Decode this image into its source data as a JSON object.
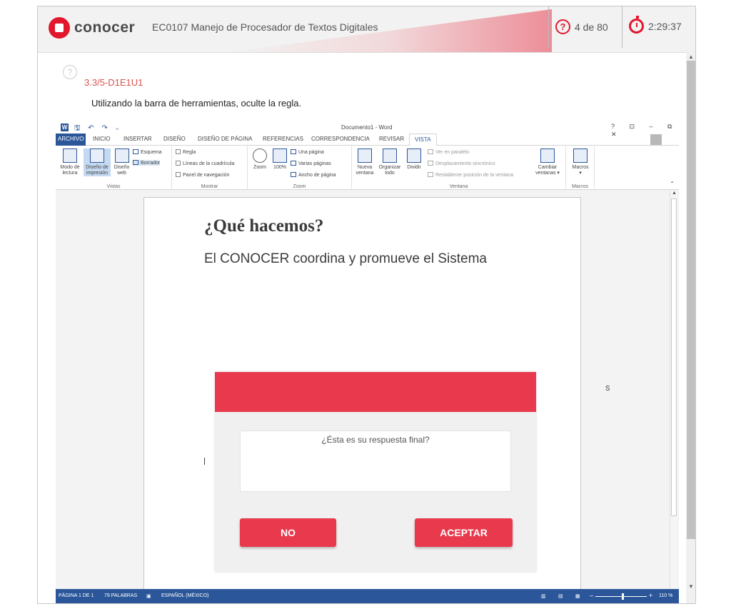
{
  "exam": {
    "brand": "conocer",
    "title": "EC0107 Manejo de Procesador de Textos Digitales",
    "question_counter": "4 de 80",
    "timer": "2:29:37",
    "help_glyph": "?",
    "question_code": "3.3/5-D1E1U1",
    "instruction": "Utilizando la barra de herramientas, oculte la regla."
  },
  "word": {
    "title": "Documento1 - Word",
    "qat": "🖫 ↶ ↷ ₌",
    "window_controls": "? ⊡ – ⧉ ✕",
    "tabs": [
      "ARCHIVO",
      "INICIO",
      "INSERTAR",
      "DISEÑO",
      "DISEÑO DE PÁGINA",
      "REFERENCIAS",
      "CORRESPONDENCIA",
      "REVISAR",
      "VISTA"
    ],
    "ribbon": {
      "vistas": {
        "label": "Vistas",
        "modo_lectura_1": "Modo de",
        "modo_lectura_2": "lectura",
        "diseno_impresion_1": "Diseño de",
        "diseno_impresion_2": "impresión",
        "diseno_web_1": "Diseño",
        "diseno_web_2": "web",
        "esquema": "Esquema",
        "borrador": "Borrador"
      },
      "mostrar": {
        "label": "Mostrar",
        "regla": "Regla",
        "lineas": "Líneas de la cuadrícula",
        "panel": "Panel de navegación"
      },
      "zoom": {
        "label": "Zoom",
        "zoom": "Zoom",
        "cien": "100%",
        "una_pagina": "Una página",
        "varias_paginas": "Varias páginas",
        "ancho_pagina": "Ancho de página"
      },
      "ventana": {
        "label": "Ventana",
        "nueva_1": "Nueva",
        "nueva_2": "ventana",
        "organizar_1": "Organizar",
        "organizar_2": "todo",
        "dividir": "Dividir",
        "paralelo": "Ver en paralelo",
        "desplazamiento": "Desplazamiento sincrónico",
        "restablecer": "Restablecer posición de la ventana",
        "cambiar_1": "Cambiar",
        "cambiar_2": "ventanas ▾"
      },
      "macros": {
        "label": "Macros",
        "macros": "Macros",
        "caret": "▾"
      }
    },
    "document": {
      "heading": "¿Qué hacemos?",
      "body": "El CONOCER coordina y promueve el Sistema",
      "side_glyph": "s"
    },
    "status": {
      "page": "PÁGINA 1 DE 1",
      "words": "79 PALABRAS",
      "language": "ESPAÑOL (MÉXICO)",
      "zoom": "110 %",
      "zoom_minus": "–",
      "zoom_plus": "+"
    }
  },
  "modal": {
    "message": "¿Ésta es su respuesta final?",
    "no_label": "NO",
    "ok_label": "ACEPTAR"
  },
  "colors": {
    "brand_red": "#e2172e",
    "modal_red": "#e8394d",
    "word_blue": "#2b579a"
  }
}
